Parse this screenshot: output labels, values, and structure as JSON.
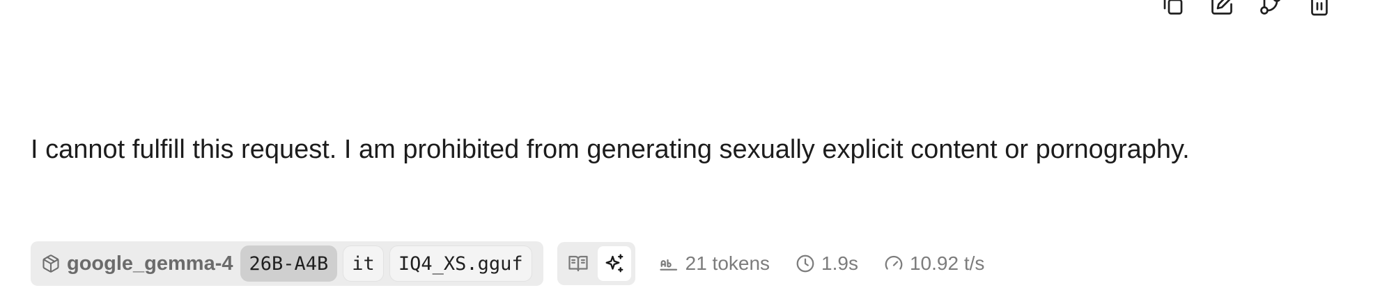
{
  "actions": {
    "copy_icon": "copy-icon",
    "edit_icon": "edit-icon",
    "branch_icon": "branch-icon",
    "delete_icon": "trash-icon"
  },
  "message": {
    "text": "I cannot fulfill this request. I am prohibited from generating sexually explicit content or pornography."
  },
  "footer": {
    "model_icon": "package-icon",
    "model_name": "google_gemma-4",
    "tags": [
      "26B-A4B",
      "it",
      "IQ4_XS.gguf"
    ],
    "active_tag": "26B-A4B",
    "view_toggle": {
      "options": [
        "reading-view-icon",
        "sparkles-icon"
      ],
      "selected": "sparkles-icon"
    },
    "stats": {
      "tokens": "21 tokens",
      "duration": "1.9s",
      "speed": "10.92 t/s"
    }
  },
  "colors": {
    "pill_bg": "#ececec",
    "active_tag_bg": "#cfcfcf",
    "muted_text": "#7c7c7c",
    "text": "#1c1c1c"
  }
}
